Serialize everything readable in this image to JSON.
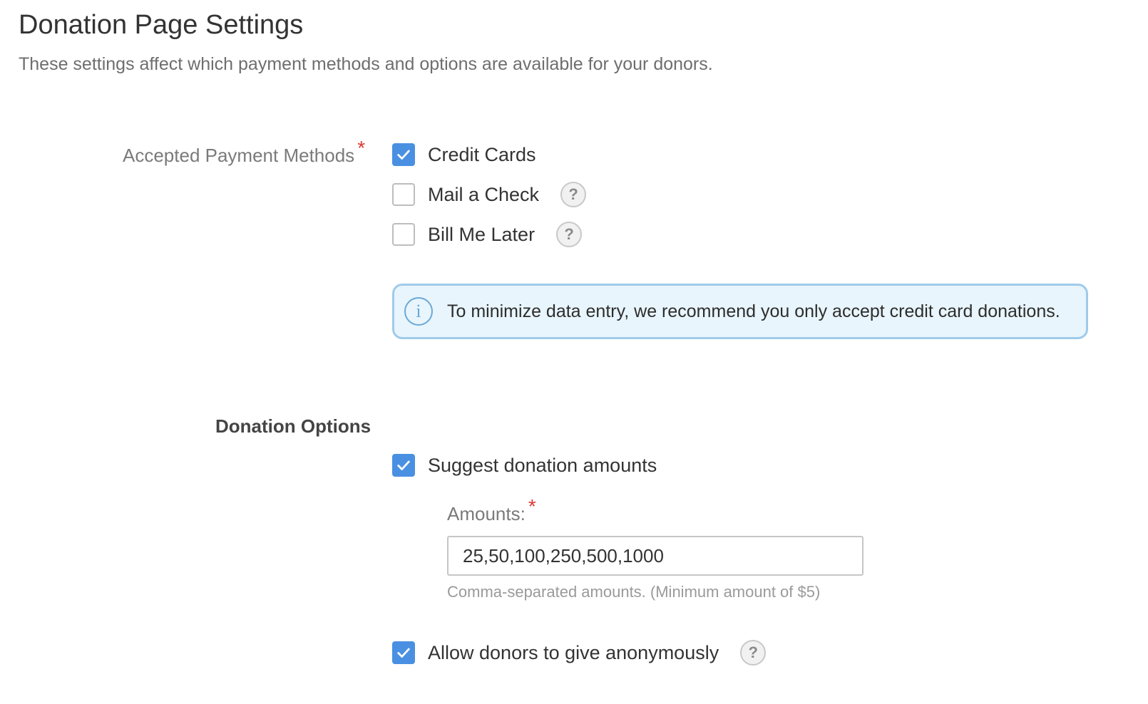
{
  "page": {
    "title": "Donation Page Settings",
    "subtitle": "These settings affect which payment methods and options are available for your donors."
  },
  "payment_methods": {
    "label": "Accepted Payment Methods",
    "required_mark": "*",
    "options": [
      {
        "label": "Credit Cards",
        "checked": true,
        "has_help": false
      },
      {
        "label": "Mail a Check",
        "checked": false,
        "has_help": true
      },
      {
        "label": "Bill Me Later",
        "checked": false,
        "has_help": true
      }
    ],
    "info_icon": "info-icon",
    "info_text": "To minimize data entry, we recommend you only accept credit card donations."
  },
  "donation_options": {
    "heading": "Donation Options",
    "suggest": {
      "label": "Suggest donation amounts",
      "checked": true
    },
    "amounts": {
      "label": "Amounts:",
      "required_mark": "*",
      "value": "25,50,100,250,500,1000",
      "helper": "Comma-separated amounts. (Minimum amount of $5)"
    },
    "anonymous": {
      "label": "Allow donors to give anonymously",
      "checked": true,
      "has_help": true
    }
  },
  "icons": {
    "help": "question-mark-icon",
    "check": "checkmark-icon"
  },
  "help_glyph": "?",
  "info_glyph": "i",
  "colors": {
    "accent": "#4a90e2",
    "required": "#d93a32",
    "info_border": "#9fcbea",
    "info_background": "#e8f5fc"
  }
}
